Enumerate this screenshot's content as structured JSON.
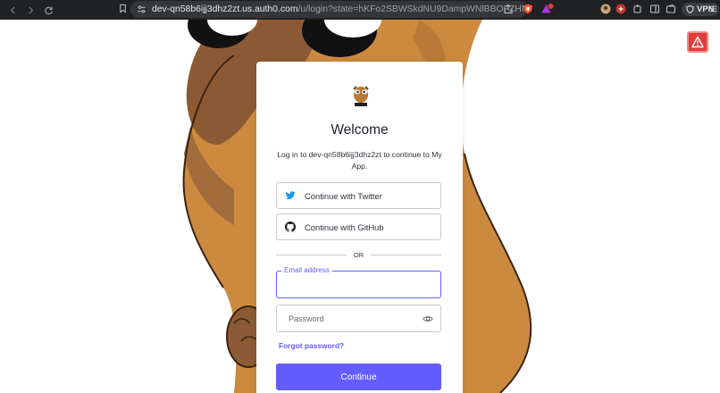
{
  "browser": {
    "url_host": "dev-qn58b6ijj3dhz2zt.us.auth0.com",
    "url_rest": "/u/login?state=hKFo2SBWSkdNU9DampWNlBBOFZHNzVOSzVoc2s4...",
    "vpn_label": "VPN"
  },
  "login": {
    "title": "Welcome",
    "description": "Log in to dev-qn58b6ijj3dhz2zt to continue to My App.",
    "twitter_label": "Continue with Twitter",
    "github_label": "Continue with GitHub",
    "or_label": "OR",
    "email_label": "Email address",
    "password_placeholder": "Password",
    "forgot_label": "Forgot password?",
    "continue_label": "Continue"
  },
  "colors": {
    "accent": "#635dff",
    "warning": "#e03c3c",
    "twitter": "#1d9bf0"
  },
  "icons": [
    "back-icon",
    "forward-icon",
    "reload-icon",
    "bookmark-icon",
    "site-settings-icon",
    "share-icon",
    "brave-shield-icon",
    "brave-rewards-icon",
    "eye-icon",
    "github-icon",
    "twitter-icon",
    "warning-icon"
  ]
}
